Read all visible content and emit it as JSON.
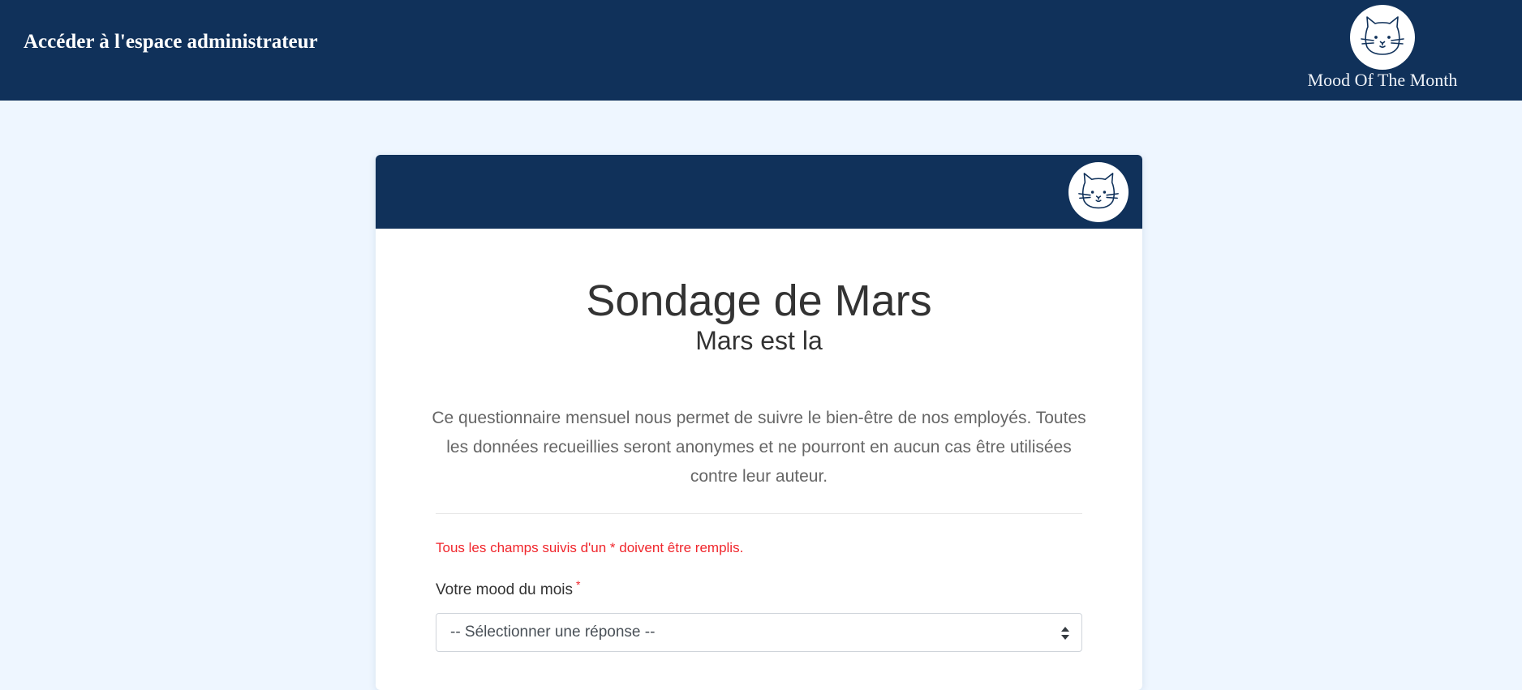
{
  "navbar": {
    "admin_link": "Accéder à l'espace administrateur",
    "brand_name": "Mood Of The Month",
    "brand_logo_icon": "cat-face-icon"
  },
  "card": {
    "header_logo_icon": "cat-face-icon",
    "title": "Sondage de Mars",
    "subtitle": "Mars est la",
    "intro": "Ce questionnaire mensuel nous permet de suivre le bien-être de nos employés. Toutes les données recueillies seront anonymes et ne pourront en aucun cas être utilisées contre leur auteur.",
    "required_note": "Tous les champs suivis d'un * doivent être remplis.",
    "mood_field": {
      "label": "Votre mood du mois",
      "required_marker": "*",
      "selected_value": "-- Sélectionner une réponse --"
    }
  },
  "colors": {
    "navy": "#10315a",
    "page_background": "#eef6ff",
    "required_red": "#f0262c"
  }
}
